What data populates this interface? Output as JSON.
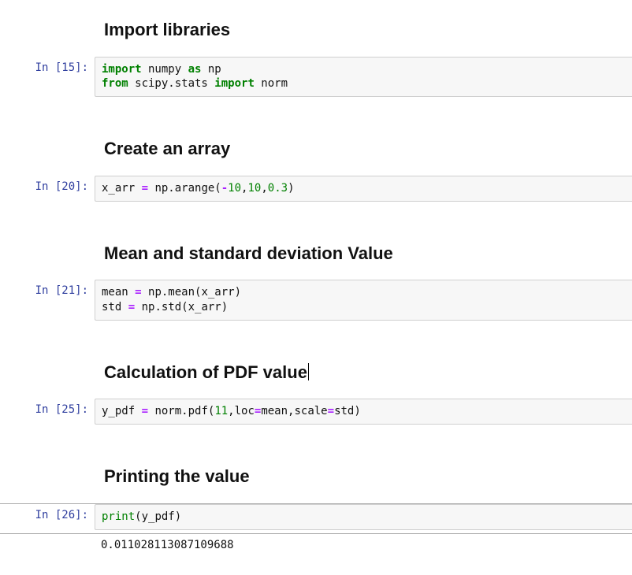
{
  "cells": [
    {
      "type": "markdown",
      "heading": "Import libraries"
    },
    {
      "type": "code",
      "prompt": "In [15]:",
      "tokens": [
        {
          "t": "import",
          "c": "kw"
        },
        {
          "t": " numpy "
        },
        {
          "t": "as",
          "c": "kw"
        },
        {
          "t": " np\n"
        },
        {
          "t": "from",
          "c": "kw"
        },
        {
          "t": " scipy.stats "
        },
        {
          "t": "import",
          "c": "kw"
        },
        {
          "t": " norm"
        }
      ]
    },
    {
      "type": "spacer"
    },
    {
      "type": "markdown",
      "heading": "Create an array"
    },
    {
      "type": "code",
      "prompt": "In [20]:",
      "tokens": [
        {
          "t": "x_arr "
        },
        {
          "t": "=",
          "c": "op"
        },
        {
          "t": " np.arange("
        },
        {
          "t": "-",
          "c": "op"
        },
        {
          "t": "10",
          "c": "num"
        },
        {
          "t": ","
        },
        {
          "t": "10",
          "c": "num"
        },
        {
          "t": ","
        },
        {
          "t": "0.3",
          "c": "num"
        },
        {
          "t": ")"
        }
      ]
    },
    {
      "type": "spacer"
    },
    {
      "type": "markdown",
      "heading": "Mean and standard deviation Value"
    },
    {
      "type": "code",
      "prompt": "In [21]:",
      "tokens": [
        {
          "t": "mean "
        },
        {
          "t": "=",
          "c": "op"
        },
        {
          "t": " np.mean(x_arr)\n"
        },
        {
          "t": "std "
        },
        {
          "t": "=",
          "c": "op"
        },
        {
          "t": " np.std(x_arr)"
        }
      ]
    },
    {
      "type": "spacer"
    },
    {
      "type": "markdown",
      "heading": "Calculation of PDF value",
      "cursor_after": true
    },
    {
      "type": "code",
      "prompt": "In [25]:",
      "tokens": [
        {
          "t": "y_pdf "
        },
        {
          "t": "=",
          "c": "op"
        },
        {
          "t": " norm.pdf("
        },
        {
          "t": "11",
          "c": "num"
        },
        {
          "t": ",loc"
        },
        {
          "t": "=",
          "c": "op"
        },
        {
          "t": "mean,scale"
        },
        {
          "t": "=",
          "c": "op"
        },
        {
          "t": "std)"
        }
      ]
    },
    {
      "type": "spacer"
    },
    {
      "type": "markdown",
      "heading": "Printing the value"
    },
    {
      "type": "code",
      "prompt": "In [26]:",
      "selected": true,
      "tokens": [
        {
          "t": "print",
          "c": "builtin"
        },
        {
          "t": "(y_pdf)"
        }
      ],
      "output": "0.011028113087109688"
    }
  ]
}
